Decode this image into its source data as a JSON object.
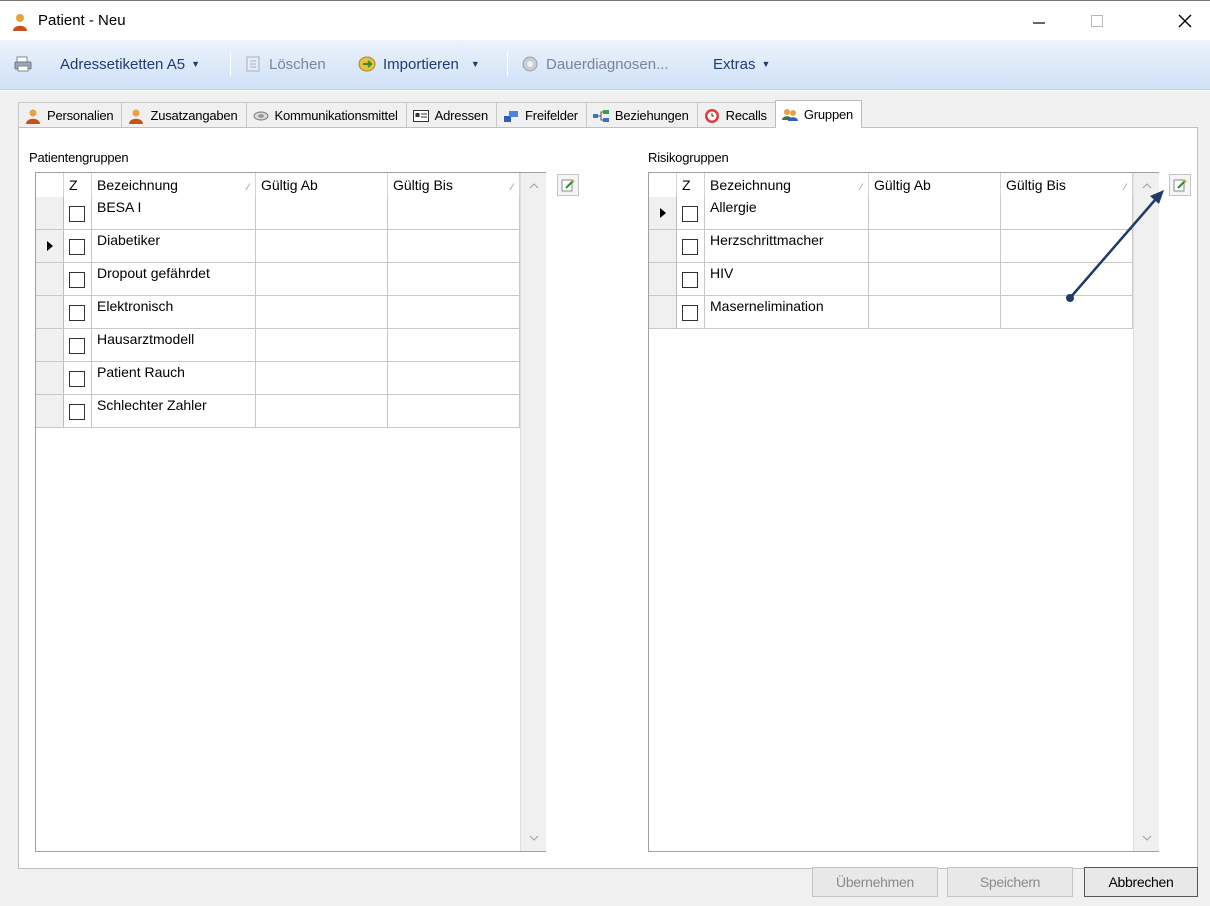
{
  "window": {
    "title": "Patient - Neu"
  },
  "toolbar": {
    "items": [
      {
        "label": "Adressetiketten A5",
        "dropdown": true,
        "enabled": true
      },
      {
        "label": "Löschen",
        "enabled": false
      },
      {
        "label": "Importieren",
        "dropdown": true,
        "enabled": true
      },
      {
        "label": "Dauerdiagnosen...",
        "enabled": false
      },
      {
        "label": "Extras",
        "dropdown": true,
        "enabled": true
      }
    ]
  },
  "tabs": [
    {
      "label": "Personalien",
      "icon": "person-icon"
    },
    {
      "label": "Zusatzangaben",
      "icon": "person-icon"
    },
    {
      "label": "Kommunikationsmittel",
      "icon": "communication-icon"
    },
    {
      "label": "Adressen",
      "icon": "address-card-icon"
    },
    {
      "label": "Freifelder",
      "icon": "fields-icon"
    },
    {
      "label": "Beziehungen",
      "icon": "relations-icon"
    },
    {
      "label": "Recalls",
      "icon": "recall-clock-icon"
    },
    {
      "label": "Gruppen",
      "icon": "group-icon",
      "active": true
    }
  ],
  "patientengruppen": {
    "label": "Patientengruppen",
    "columns": [
      "Z",
      "Bezeichnung",
      "Gültig Ab",
      "Gültig Bis"
    ],
    "rows": [
      {
        "name": "BESA I",
        "checked": false,
        "current": false
      },
      {
        "name": "Diabetiker",
        "checked": false,
        "current": true
      },
      {
        "name": "Dropout gefährdet",
        "checked": false,
        "current": false
      },
      {
        "name": "Elektronisch",
        "checked": false,
        "current": false
      },
      {
        "name": "Hausarztmodell",
        "checked": false,
        "current": false
      },
      {
        "name": "Patient Rauch",
        "checked": false,
        "current": false
      },
      {
        "name": "Schlechter Zahler",
        "checked": false,
        "current": false
      }
    ]
  },
  "risikogruppen": {
    "label": "Risikogruppen",
    "columns": [
      "Z",
      "Bezeichnung",
      "Gültig Ab",
      "Gültig Bis"
    ],
    "rows": [
      {
        "name": "Allergie",
        "checked": false,
        "current": true
      },
      {
        "name": "Herzschrittmacher",
        "checked": false,
        "current": false
      },
      {
        "name": "HIV",
        "checked": false,
        "current": false
      },
      {
        "name": "Masernelimination",
        "checked": false,
        "current": false
      }
    ]
  },
  "buttons": {
    "apply": "Übernehmen",
    "save": "Speichern",
    "cancel": "Abbrechen"
  },
  "colors": {
    "toolbar_text": "#1f3b7a",
    "annotation_arrow": "#1f3a68"
  }
}
